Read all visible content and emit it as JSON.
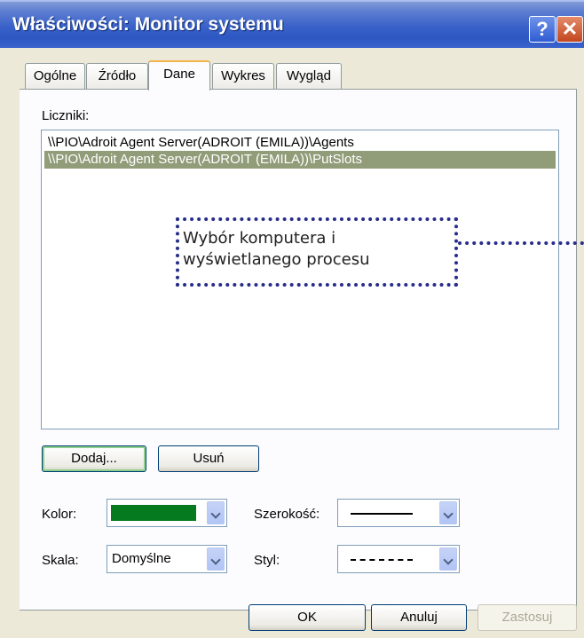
{
  "window": {
    "title": "Właściwości: Monitor systemu",
    "help_label": "?",
    "close_label": "✕"
  },
  "tabs": [
    {
      "label": "Ogólne",
      "active": false
    },
    {
      "label": "Źródło",
      "active": false
    },
    {
      "label": "Dane",
      "active": true
    },
    {
      "label": "Wykres",
      "active": false
    },
    {
      "label": "Wygląd",
      "active": false
    }
  ],
  "counters": {
    "label": "Liczniki:",
    "items": [
      "\\\\PIO\\Adroit Agent Server(ADROIT (EMILA))\\Agents",
      "\\\\PIO\\Adroit Agent Server(ADROIT (EMILA))\\PutSlots"
    ],
    "selected_index": 1
  },
  "annotation": {
    "line1": "Wybór komputera i",
    "line2": "wyświetlanego procesu",
    "color": "#272d8a"
  },
  "buttons": {
    "add": "Dodaj...",
    "remove": "Usuń",
    "ok": "OK",
    "cancel": "Anuluj",
    "apply": "Zastosuj"
  },
  "fields": {
    "color_label": "Kolor:",
    "color_value": "#067a1f",
    "width_label": "Szerokość:",
    "scale_label": "Skala:",
    "scale_value": "Domyślne",
    "style_label": "Styl:"
  },
  "icons": {
    "dropdown": "chevron-down-icon",
    "help": "help-icon",
    "close": "close-icon"
  }
}
